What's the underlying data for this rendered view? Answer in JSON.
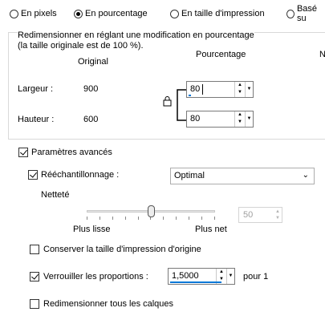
{
  "size_modes": [
    {
      "label": "En pixels",
      "selected": false
    },
    {
      "label": "En pourcentage",
      "selected": true
    },
    {
      "label": "En taille d'impression",
      "selected": false
    },
    {
      "label": "Basé su",
      "selected": false
    }
  ],
  "group": {
    "description": "Redimensionner en réglant une modification en pourcentage\n(la taille originale est de 100 %).",
    "col_original": "Original",
    "col_percentage": "Pourcentage",
    "col_cut": "N",
    "width_label": "Largeur :",
    "width_original": "900",
    "width_percent": "80",
    "height_label": "Hauteur :",
    "height_original": "600",
    "height_percent": "80"
  },
  "advanced": {
    "label": "Paramètres avancés",
    "checked": true
  },
  "resample": {
    "label": "Rééchantillonnage :",
    "checked": true,
    "selected": "Optimal"
  },
  "sharpness": {
    "label": "Netteté",
    "min_label": "Plus lisse",
    "max_label": "Plus net",
    "value": "50",
    "level": 0.5
  },
  "keep_print_size": {
    "label": "Conserver la taille d'impression d'origine",
    "checked": false
  },
  "lock_ratio": {
    "label": "Verrouiller les proportions :",
    "checked": true,
    "value": "1,5000",
    "suffix": "pour 1"
  },
  "resize_layers": {
    "label": "Redimensionner tous les calques",
    "checked": false
  }
}
